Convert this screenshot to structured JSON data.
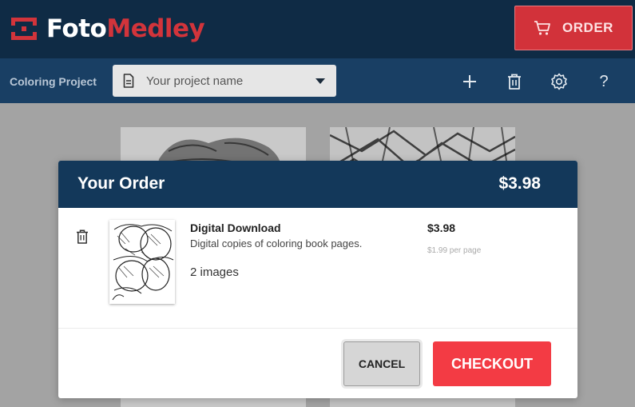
{
  "header": {
    "logo_part1": "Foto",
    "logo_part2": "Medley",
    "order_label": "ORDER",
    "icons": [
      "logo-icon",
      "cart-icon"
    ]
  },
  "project_bar": {
    "label": "Coloring Project",
    "name_placeholder": "Your project name",
    "tools": [
      "plus-icon",
      "trash-icon",
      "gear-icon",
      "help-icon"
    ],
    "help_glyph": "?"
  },
  "modal": {
    "title": "Your Order",
    "total": "$3.98",
    "item": {
      "name": "Digital Download",
      "description": "Digital copies of coloring book pages.",
      "count": "2 images",
      "price": "$3.98",
      "unit_price": "$1.99 per page"
    },
    "cancel_label": "CANCEL",
    "checkout_label": "CHECKOUT"
  },
  "colors": {
    "header_bg": "#0f2b45",
    "project_bar_bg": "#193f64",
    "brand_red": "#d2343b",
    "checkout_red": "#f33b44",
    "modal_header_bg": "#13385a"
  }
}
